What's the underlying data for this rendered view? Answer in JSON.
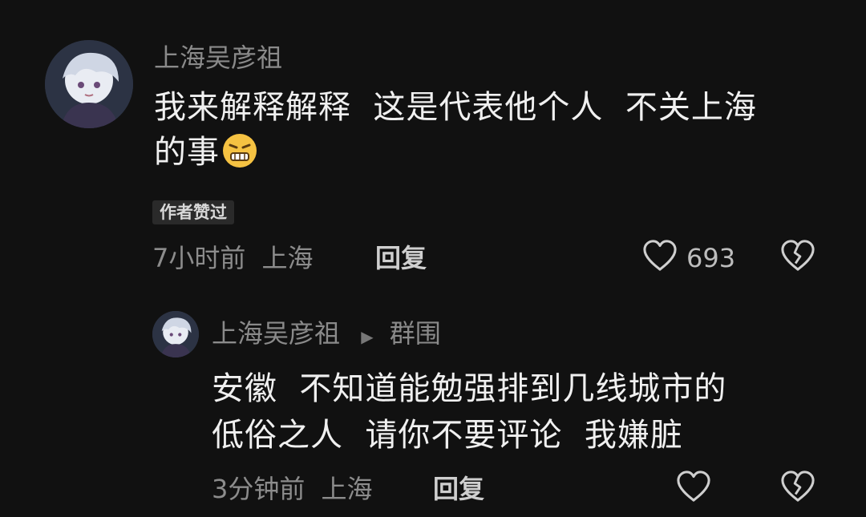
{
  "comment": {
    "username": "上海吴彦祖",
    "text_line1": "我来解释解释  这是代表他个人  不关上海",
    "text_line2": "的事",
    "emoji": "grimacing-face-icon",
    "badge": "作者赞过",
    "time": "7小时前",
    "location": "上海",
    "reply_label": "回复",
    "like_count": "693"
  },
  "reply": {
    "username": "上海吴彦祖",
    "reply_to": "群围",
    "text_line1": "安徽  不知道能勉强排到几线城市的",
    "text_line2": "低俗之人  请你不要评论  我嫌脏",
    "time": "3分钟前",
    "location": "上海",
    "reply_label": "回复"
  },
  "colors": {
    "background": "#111111",
    "primary_text": "#f0f0f0",
    "secondary_text": "#8a8a8a"
  }
}
